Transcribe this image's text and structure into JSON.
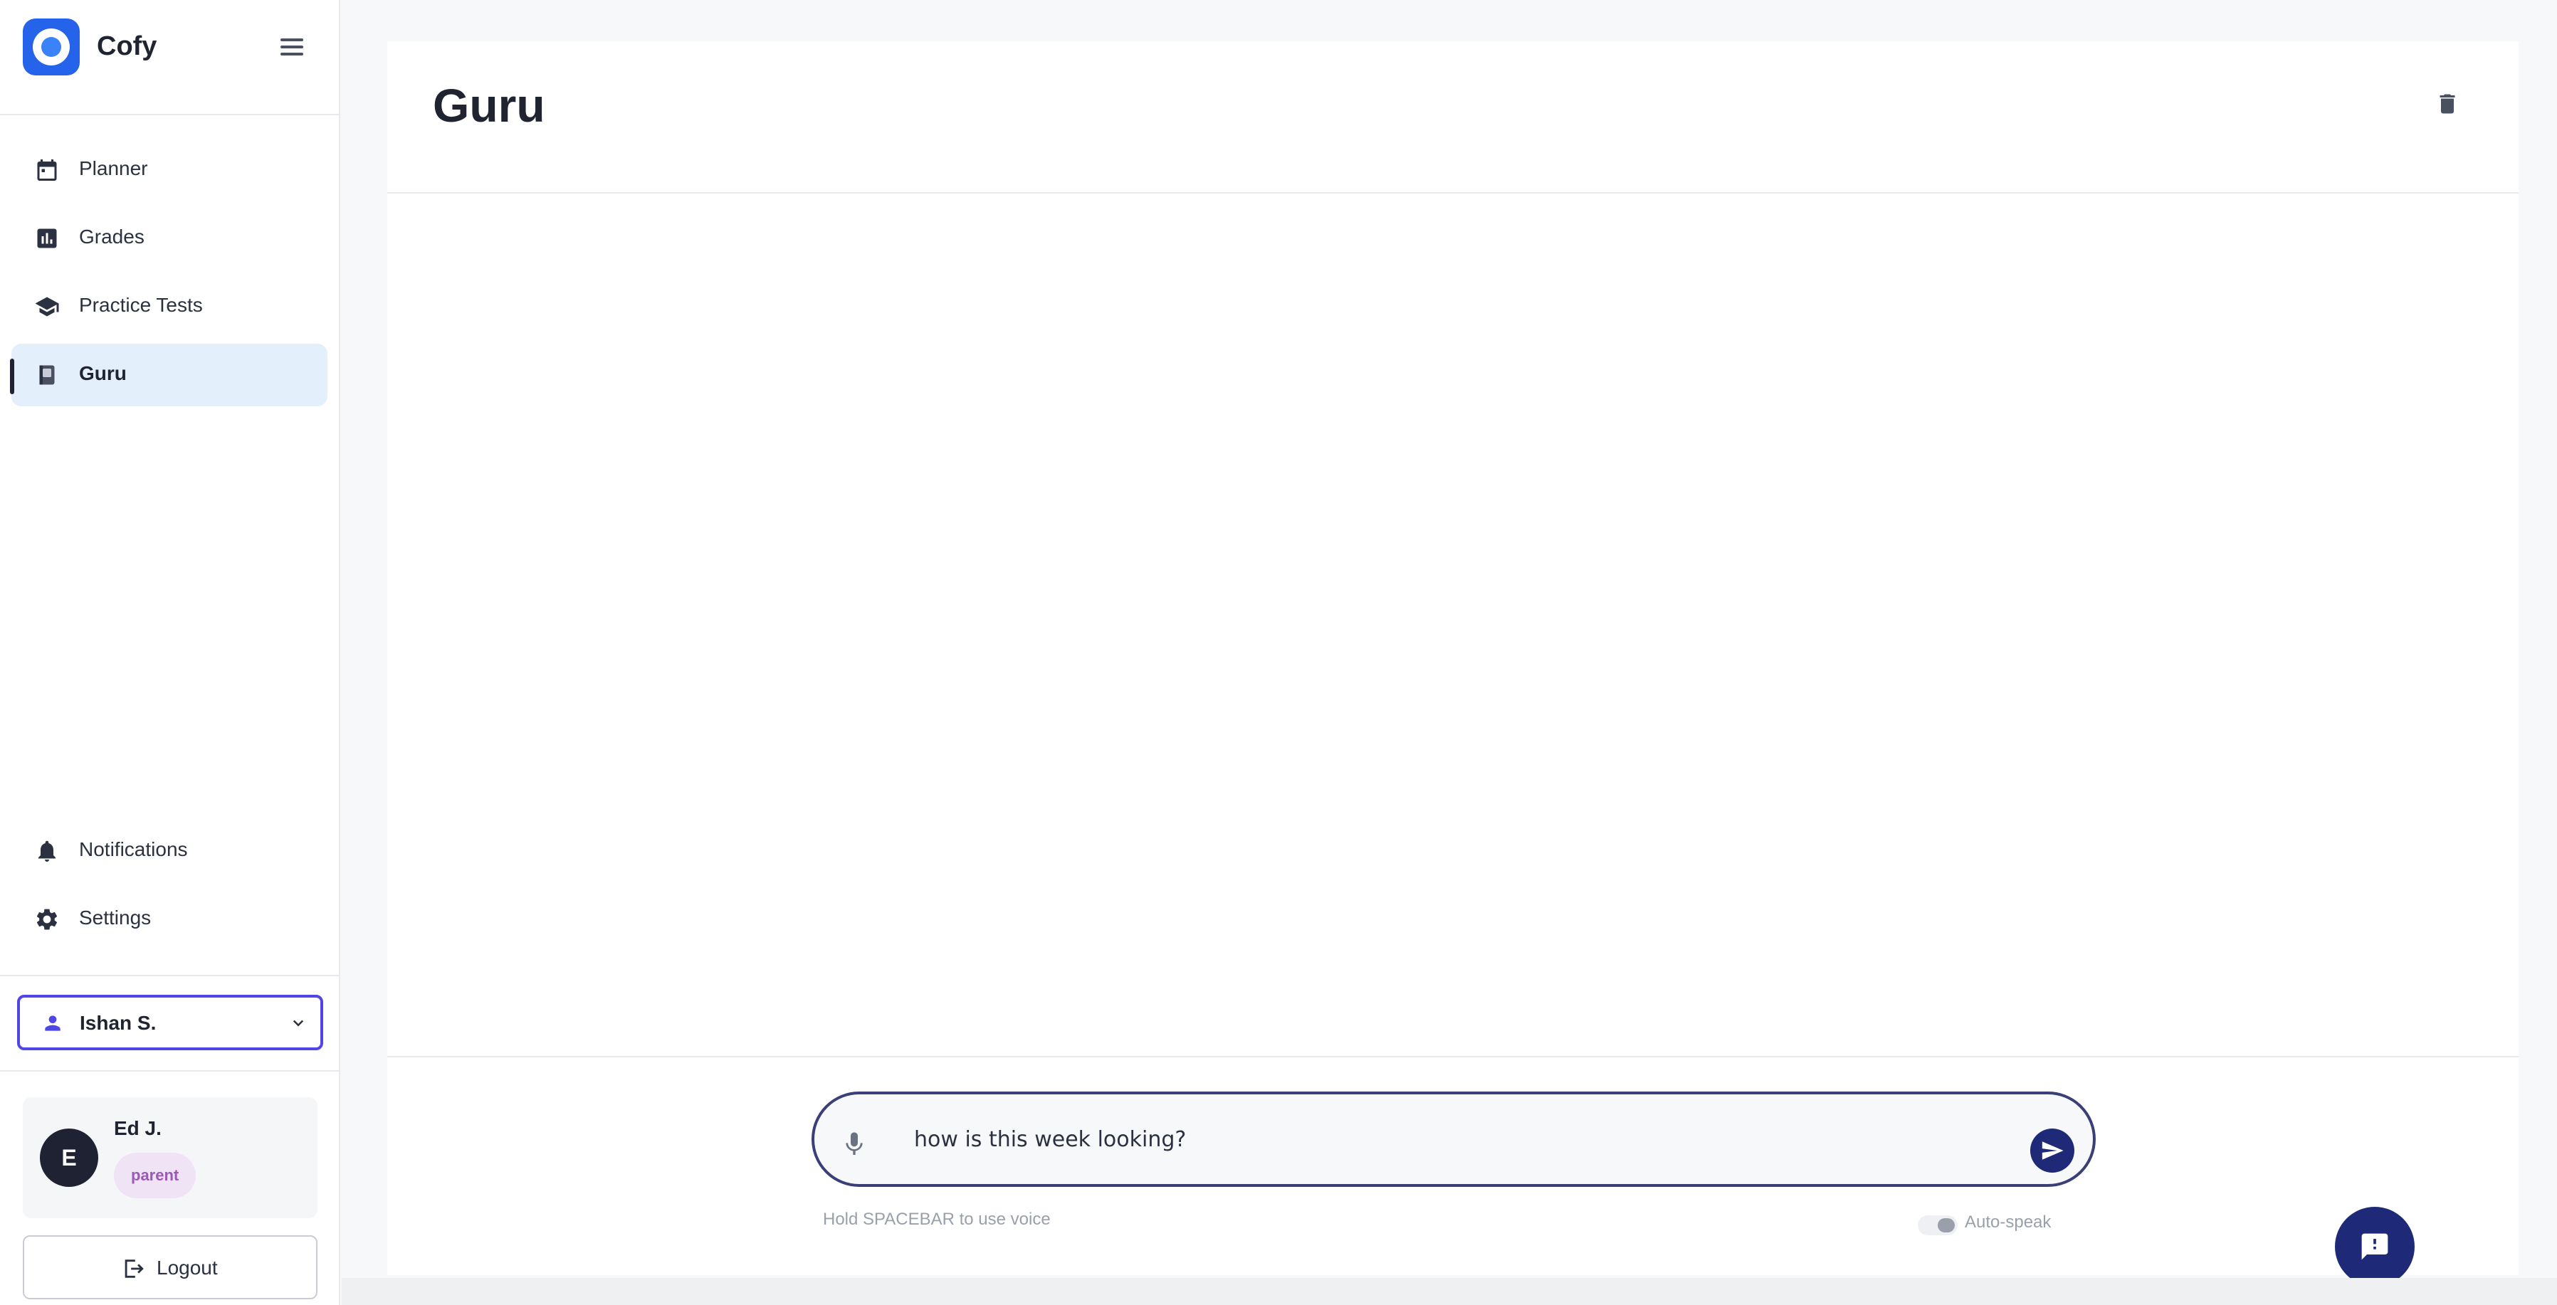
{
  "app": {
    "brand_name": "Cofy",
    "colors": {
      "accent": "#4f46e5",
      "primary_dark": "#1e2a78",
      "active_bg": "#e3effb",
      "badge_bg": "#f0e3f5",
      "badge_text": "#9b59b6"
    }
  },
  "sidebar": {
    "menu_icon": "hamburger-icon",
    "items": [
      {
        "label": "Planner",
        "icon": "calendar-icon",
        "active": false
      },
      {
        "label": "Grades",
        "icon": "bar-chart-icon",
        "active": false
      },
      {
        "label": "Practice Tests",
        "icon": "graduation-cap-icon",
        "active": false
      },
      {
        "label": "Guru",
        "icon": "book-icon",
        "active": true
      }
    ],
    "bottom_items": [
      {
        "label": "Notifications",
        "icon": "bell-icon"
      },
      {
        "label": "Settings",
        "icon": "gear-icon"
      }
    ],
    "student_selector": {
      "name": "Ishan S.",
      "icon": "person-icon"
    },
    "profile": {
      "initial": "E",
      "name": "Ed J.",
      "role": "parent"
    },
    "logout_label": "Logout"
  },
  "main": {
    "title": "Guru",
    "chat": {
      "input_value": "how is this week looking?",
      "hint": "Hold SPACEBAR to use voice",
      "auto_speak_label": "Auto-speak",
      "auto_speak_on": false
    }
  }
}
